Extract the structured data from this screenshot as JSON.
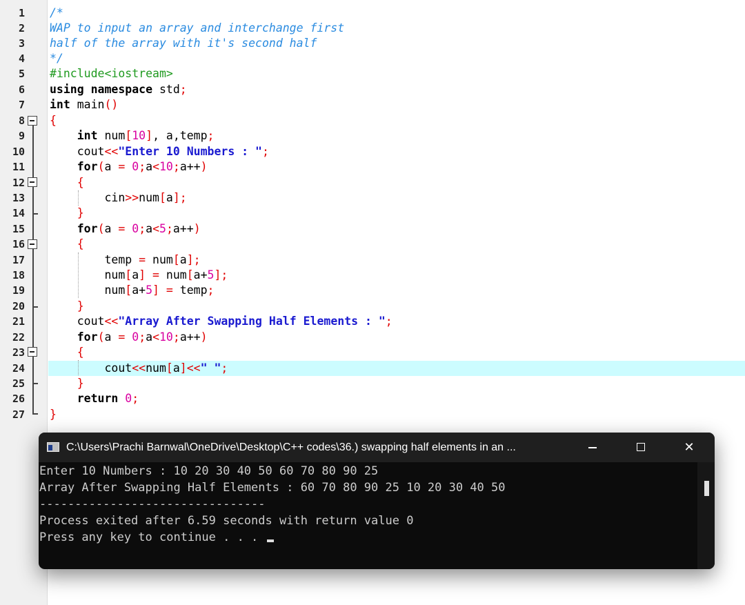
{
  "editor": {
    "lines": [
      {
        "n": "1"
      },
      {
        "n": "2"
      },
      {
        "n": "3"
      },
      {
        "n": "4"
      },
      {
        "n": "5"
      },
      {
        "n": "6"
      },
      {
        "n": "7"
      },
      {
        "n": "8"
      },
      {
        "n": "9"
      },
      {
        "n": "10"
      },
      {
        "n": "11"
      },
      {
        "n": "12"
      },
      {
        "n": "13"
      },
      {
        "n": "14"
      },
      {
        "n": "15"
      },
      {
        "n": "16"
      },
      {
        "n": "17"
      },
      {
        "n": "18"
      },
      {
        "n": "19"
      },
      {
        "n": "20"
      },
      {
        "n": "21"
      },
      {
        "n": "22"
      },
      {
        "n": "23"
      },
      {
        "n": "24"
      },
      {
        "n": "25"
      },
      {
        "n": "26"
      },
      {
        "n": "27"
      }
    ],
    "code": {
      "l1": "/*",
      "l2": "WAP to input an array and interchange first",
      "l3": "half of the array with it's second half",
      "l4": "*/",
      "l5": "#include<iostream>",
      "l6a": "using namespace",
      "l6b": " std",
      "l6c": ";",
      "l7a": "int",
      "l7b": " main",
      "l7c": "()",
      "brace_open": "{",
      "brace_close": "}",
      "int_kw": "int",
      "num": "num",
      "ten": "10",
      "decl_tail": ", a,temp",
      "semi": ";",
      "cout": "cout",
      "shl": "<<",
      "shr": ">>",
      "cin": "cin",
      "enter_str": "\"Enter 10 Numbers : \"",
      "for_kw": "for",
      "lparen": "(",
      "rparen": ")",
      "a_eq": "a ",
      "eq": "=",
      "zero": "0",
      "a_lt": "a",
      "lt": "<",
      "a_pp": "a++",
      "five": "5",
      "lbr": "[",
      "rbr": "]",
      "a": "a",
      "aplus": "a+",
      "temp": "temp",
      "swap_str": "\"Array After Swapping Half Elements : \"",
      "space_str": "\" \"",
      "return_kw": "return"
    }
  },
  "console": {
    "title": "C:\\Users\\Prachi Barnwal\\OneDrive\\Desktop\\C++ codes\\36.) swapping half elements in an ...",
    "lines": [
      "Enter 10 Numbers : 10 20 30 40 50 60 70 80 90 25",
      "Array After Swapping Half Elements : 60 70 80 90 25 10 20 30 40 50",
      "--------------------------------",
      "Process exited after 6.59 seconds with return value 0",
      "Press any key to continue . . . "
    ],
    "close_glyph": "✕"
  },
  "colors": {
    "comment": "#2a8be0",
    "preprocessor": "#1f9a1f",
    "string": "#1a1ad0",
    "number": "#d900a0",
    "symbol": "#e00000",
    "current_line": "#ccfcff",
    "console_bg": "#0c0c0c"
  }
}
